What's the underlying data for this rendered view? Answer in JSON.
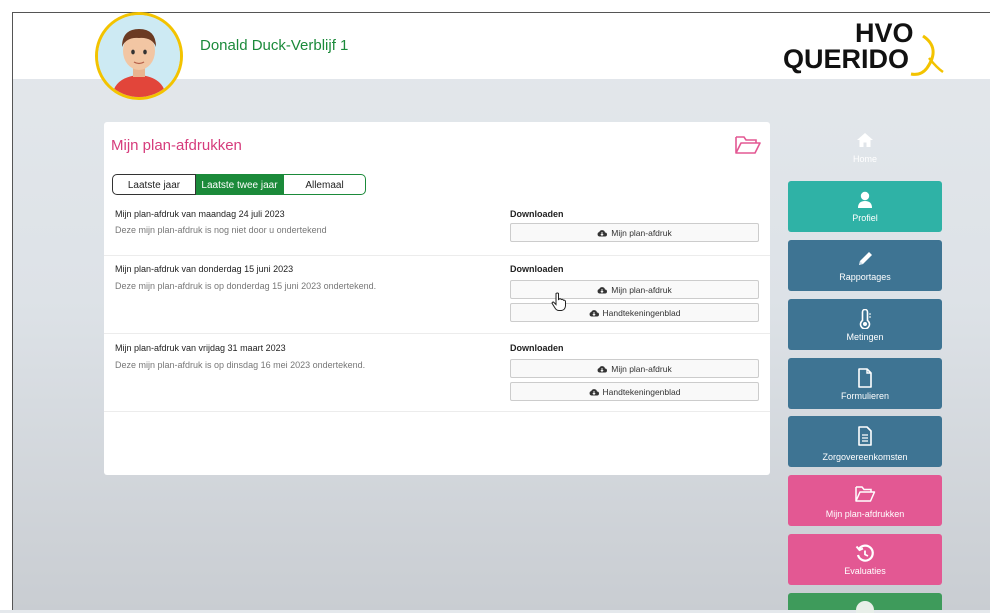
{
  "header": {
    "user_name": "Donald Duck-Verblijf 1",
    "logo_line1": "HVO",
    "logo_line2": "QUERIDO"
  },
  "panel": {
    "title": "Mijn plan-afdrukken",
    "filters": [
      "Laatste jaar",
      "Laatste twee jaar",
      "Allemaal"
    ],
    "active_filter": "Laatste twee jaar",
    "entries": [
      {
        "title": "Mijn plan-afdruk van maandag 24 juli 2023",
        "desc": "Deze mijn plan-afdruk is nog niet door u ondertekend",
        "download_label": "Downloaden",
        "buttons": [
          "Mijn plan-afdruk"
        ]
      },
      {
        "title": "Mijn plan-afdruk van donderdag 15 juni 2023",
        "desc": "Deze mijn plan-afdruk is op donderdag 15 juni 2023 ondertekend.",
        "download_label": "Downloaden",
        "buttons": [
          "Mijn plan-afdruk",
          "Handtekeningenblad"
        ]
      },
      {
        "title": "Mijn plan-afdruk van vrijdag 31 maart 2023",
        "desc": "Deze mijn plan-afdruk is op dinsdag 16 mei 2023 ondertekend.",
        "download_label": "Downloaden",
        "buttons": [
          "Mijn plan-afdruk",
          "Handtekeningenblad"
        ]
      }
    ]
  },
  "sidebar": {
    "items": [
      {
        "label": "Home",
        "icon": "home-icon"
      },
      {
        "label": "Profiel",
        "icon": "person-icon",
        "color": "#2fb2a6"
      },
      {
        "label": "Rapportages",
        "icon": "pencil-icon",
        "color": "#3e7493"
      },
      {
        "label": "Metingen",
        "icon": "thermometer-icon",
        "color": "#3e7493"
      },
      {
        "label": "Formulieren",
        "icon": "file-icon",
        "color": "#3e7493"
      },
      {
        "label": "Zorgovereenkomsten",
        "icon": "file-text-icon",
        "color": "#3e7493"
      },
      {
        "label": "Mijn plan-afdrukken",
        "icon": "folder-open-icon",
        "color": "#e35893"
      },
      {
        "label": "Evaluaties",
        "icon": "history-icon",
        "color": "#e35893"
      }
    ]
  },
  "colors": {
    "accent_green": "#1b8a3a",
    "accent_pink": "#d63c7c",
    "avatar_ring": "#f3c300"
  }
}
